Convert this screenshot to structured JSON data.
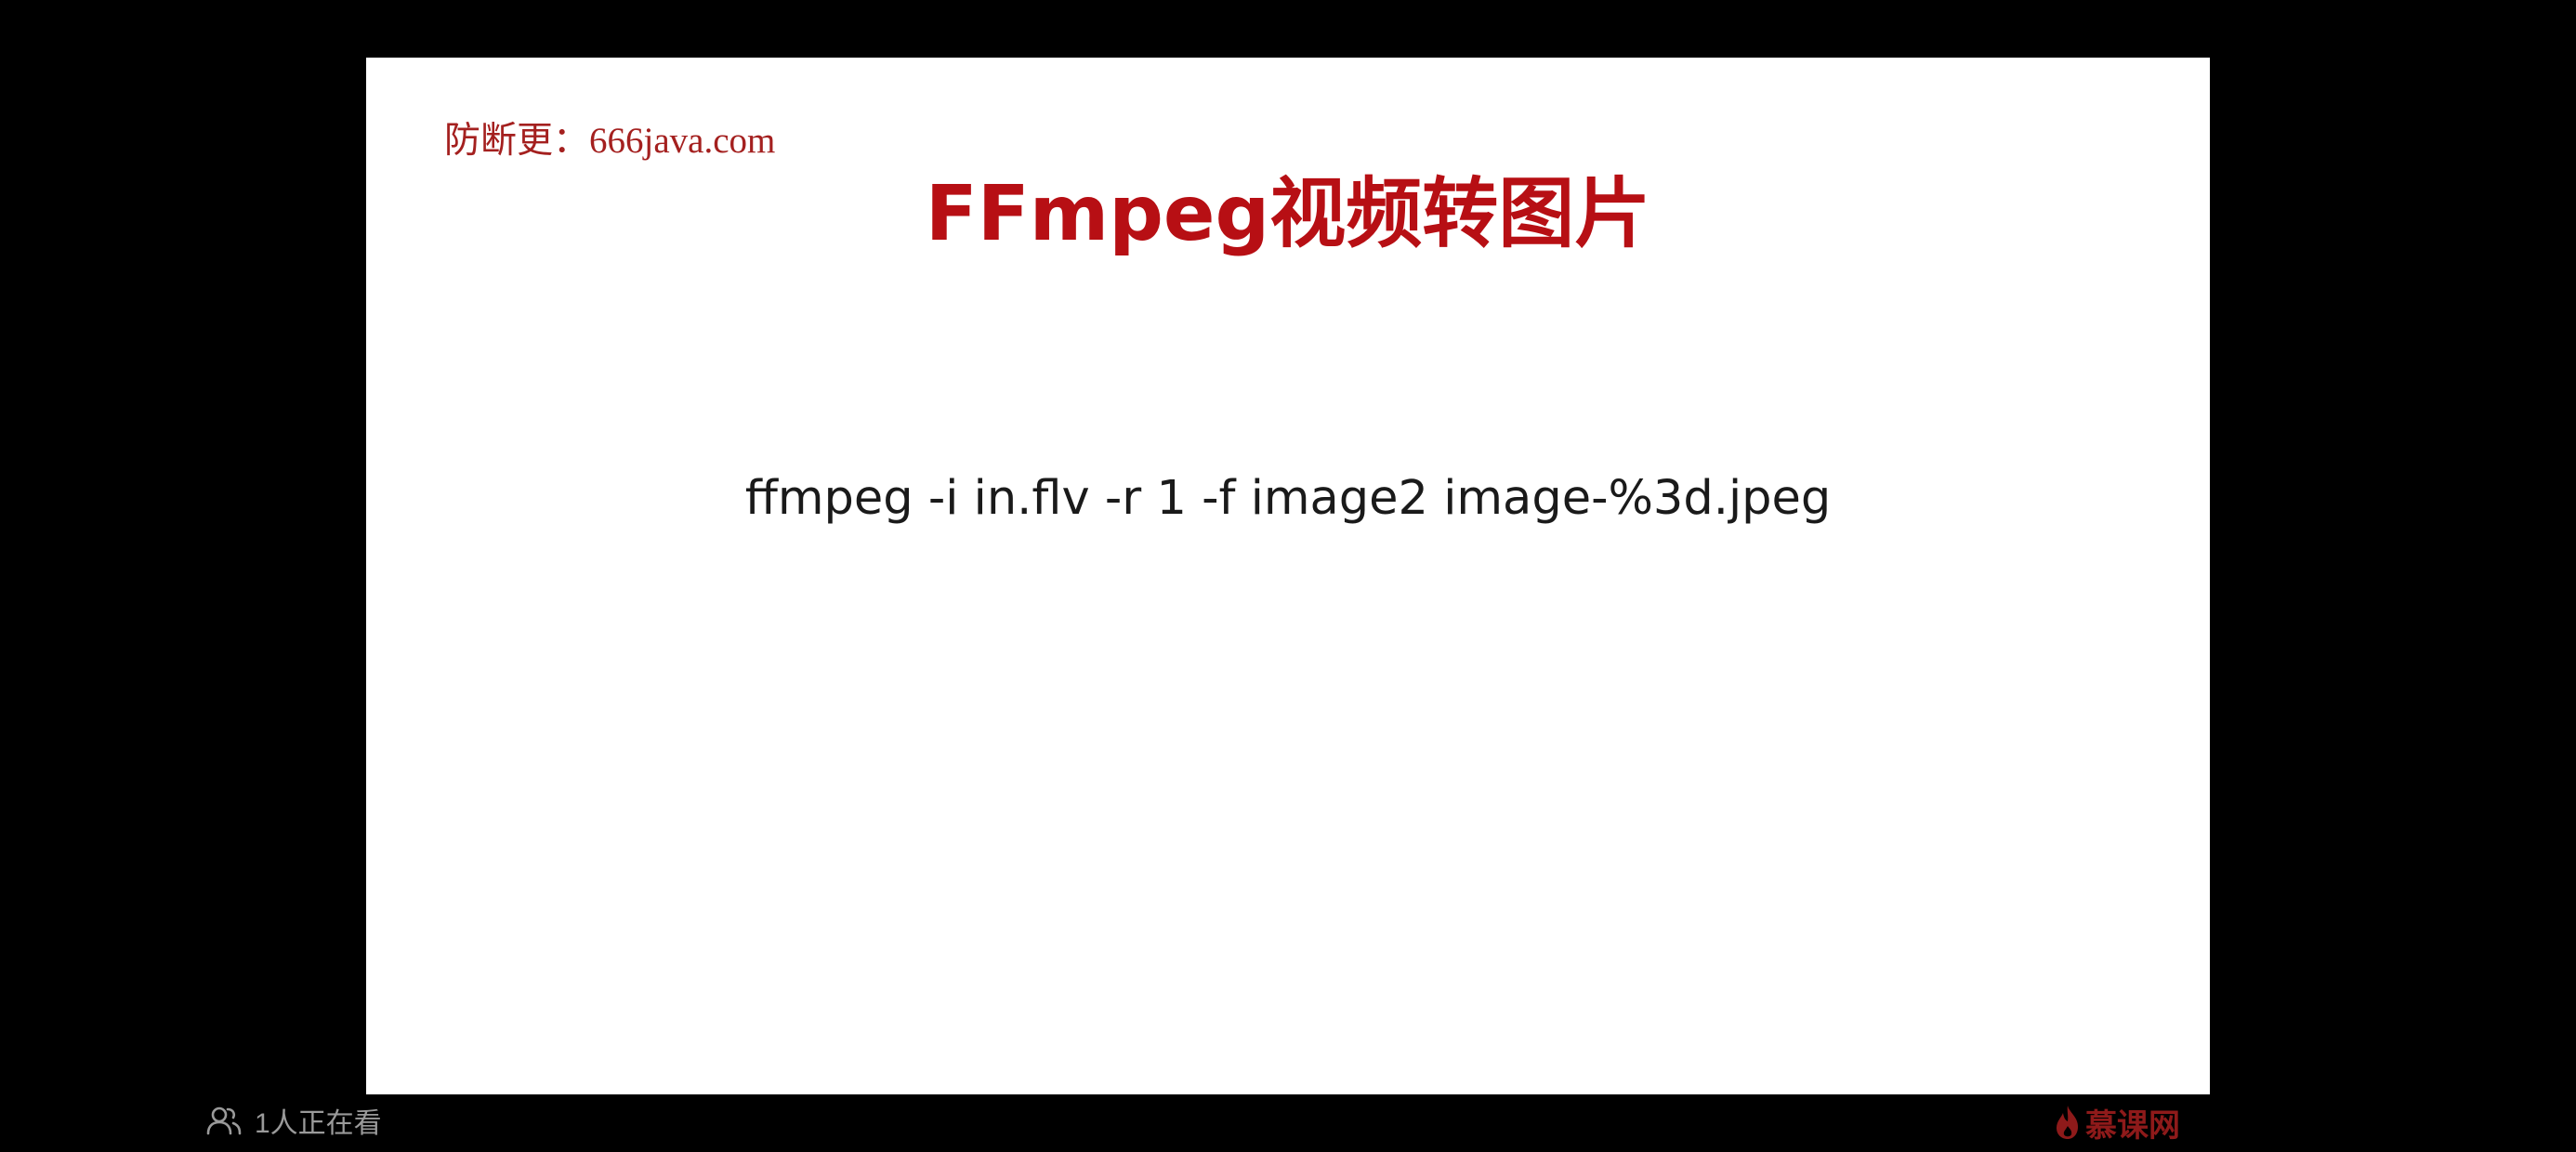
{
  "slide": {
    "watermark": "防断更：666java.com",
    "title": "FFmpeg视频转图片",
    "command": "ffmpeg -i in.flv -r 1 -f image2 image-%3d.jpeg"
  },
  "footer": {
    "viewer_icon": "people-icon",
    "viewer_count_text": "1人正在看",
    "brand_icon": "flame-icon",
    "brand_text": "慕课网"
  },
  "colors": {
    "background": "#000000",
    "slide": "#ffffff",
    "title": "#b70f14",
    "watermark": "#a4201f",
    "command": "#1a1a1a",
    "footer_text": "#9a9a9a",
    "brand": "#8e1a1a"
  }
}
